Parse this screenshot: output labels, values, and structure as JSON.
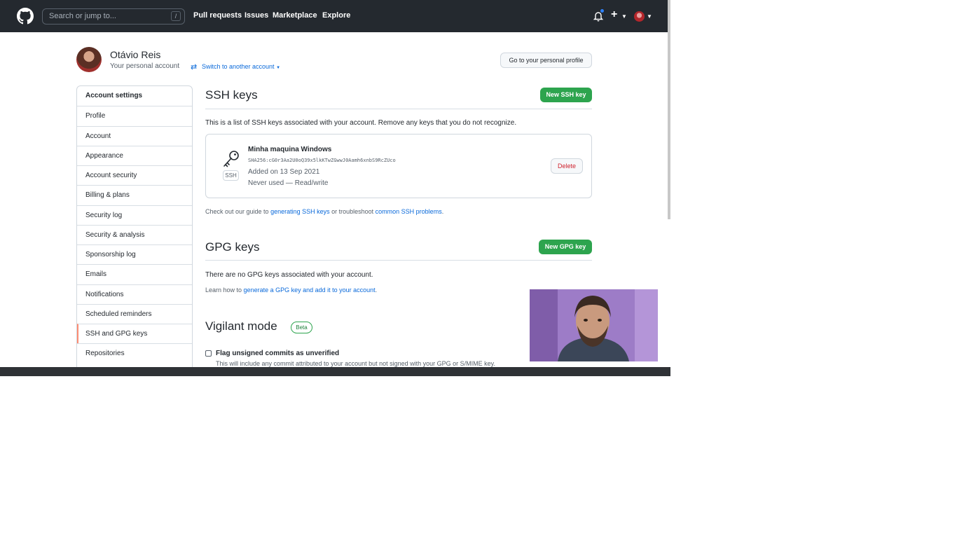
{
  "header": {
    "search_placeholder": "Search or jump to...",
    "search_shortcut": "/",
    "nav": [
      "Pull requests",
      "Issues",
      "Marketplace",
      "Explore"
    ],
    "icons": [
      "github-logo-icon",
      "bell-icon",
      "plus-icon",
      "avatar"
    ]
  },
  "account": {
    "name": "Otávio Reis",
    "subtitle": "Your personal account",
    "switch_label": "Switch to another account",
    "profile_button": "Go to your personal profile"
  },
  "sidebar": {
    "items": [
      {
        "label": "Account settings"
      },
      {
        "label": "Profile"
      },
      {
        "label": "Account"
      },
      {
        "label": "Appearance"
      },
      {
        "label": "Account security"
      },
      {
        "label": "Billing & plans"
      },
      {
        "label": "Security log"
      },
      {
        "label": "Security & analysis"
      },
      {
        "label": "Sponsorship log"
      },
      {
        "label": "Emails"
      },
      {
        "label": "Notifications"
      },
      {
        "label": "Scheduled reminders"
      },
      {
        "label": "SSH and GPG keys"
      },
      {
        "label": "Repositories"
      }
    ],
    "selected": "SSH and GPG keys"
  },
  "ssh": {
    "title": "SSH keys",
    "new_button": "New SSH key",
    "description": "This is a list of SSH keys associated with your account. Remove any keys that you do not recognize.",
    "key": {
      "title": "Minha maquina Windows",
      "fingerprint": "SHA256:cG0r3Aa2U0oQ39x5lkKTwZGwwJ0Aamh6xnbS9RcZUco",
      "added": "Added on 13 Sep 2021",
      "usage": "Never used — Read/write",
      "badge": "SSH",
      "delete_button": "Delete"
    },
    "guide_prefix": "Check out our guide to ",
    "guide_link1": "generating SSH keys",
    "guide_middle": " or troubleshoot ",
    "guide_link2": "common SSH problems",
    "guide_suffix": "."
  },
  "gpg": {
    "title": "GPG keys",
    "new_button": "New GPG key",
    "empty": "There are no GPG keys associated with your account.",
    "learn_prefix": "Learn how to ",
    "learn_link": "generate a GPG key and add it to your account",
    "learn_suffix": "."
  },
  "vigilant": {
    "title": "Vigilant mode",
    "badge": "Beta",
    "checkbox_label": "Flag unsigned commits as unverified",
    "checkbox_help": "This will include any commit attributed to your account but not signed with your GPG or S/MIME key."
  },
  "colors": {
    "header_bg": "#24292f",
    "primary_button": "#2da44e",
    "link": "#0969da",
    "danger": "#cf222e",
    "selected_accent": "#fd8c73"
  }
}
